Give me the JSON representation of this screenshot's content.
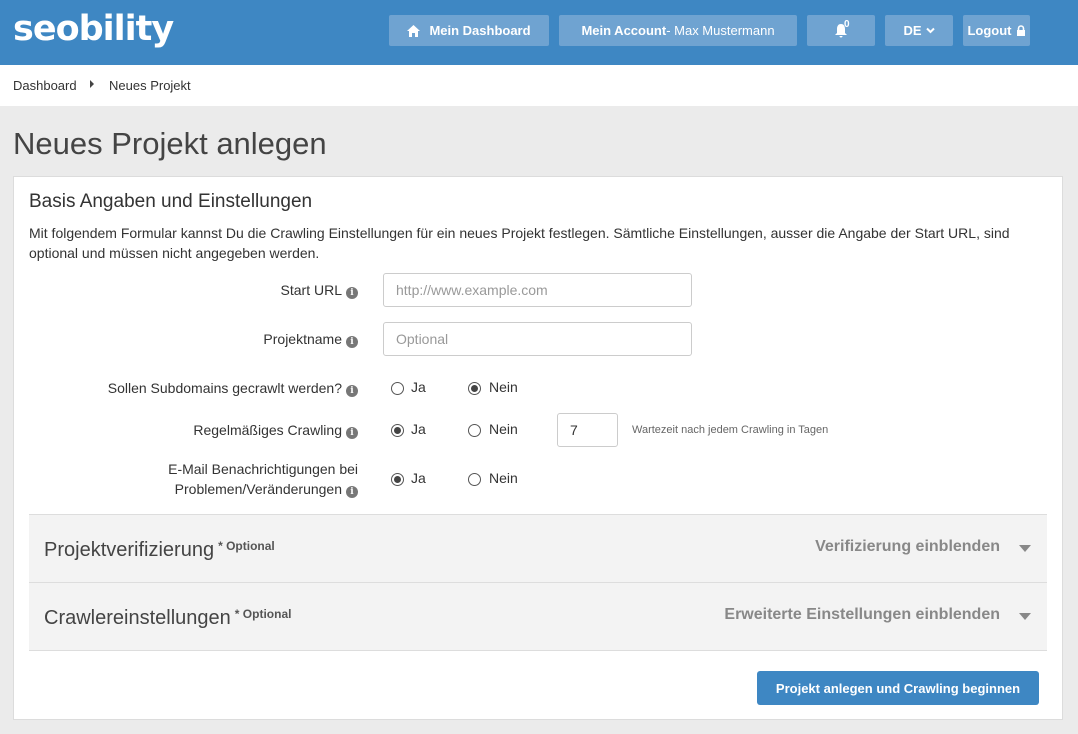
{
  "app": {
    "logo": "seobility"
  },
  "nav": {
    "dashboard": "Mein Dashboard",
    "account_label": "Mein Account",
    "account_user": " - Max Mustermann",
    "notifications_count": "0",
    "language": "DE",
    "logout": "Logout"
  },
  "breadcrumb": {
    "home": "Dashboard",
    "current": "Neues Projekt"
  },
  "page": {
    "title": "Neues Projekt anlegen"
  },
  "form": {
    "section_title": "Basis Angaben und Einstellungen",
    "description": "Mit folgendem Formular kannst Du die Crawling Einstellungen für ein neues Projekt festlegen. Sämtliche Einstellungen, ausser die Angabe der Start URL, sind optional und müssen nicht angegeben werden.",
    "start_url": {
      "label": "Start URL",
      "placeholder": "http://www.example.com",
      "value": ""
    },
    "project_name": {
      "label": "Projektname",
      "placeholder": "Optional",
      "value": ""
    },
    "subdomains": {
      "label": "Sollen Subdomains gecrawlt werden?",
      "yes": "Ja",
      "no": "Nein",
      "selected": "Nein"
    },
    "regular_crawling": {
      "label": "Regelmäßiges Crawling",
      "yes": "Ja",
      "no": "Nein",
      "selected": "Ja",
      "days_value": "7",
      "days_hint": "Wartezeit nach jedem Crawling in Tagen"
    },
    "email_notifications": {
      "label_line1": "E-Mail Benachrichtigungen bei",
      "label_line2": "Problemen/Veränderungen",
      "yes": "Ja",
      "no": "Nein",
      "selected": "Ja"
    }
  },
  "panels": {
    "verification": {
      "title": "Projektverifizierung",
      "optional": "* Optional",
      "toggle": "Verifizierung einblenden"
    },
    "crawler": {
      "title": "Crawlereinstellungen",
      "optional": "* Optional",
      "toggle": "Erweiterte Einstellungen einblenden"
    }
  },
  "actions": {
    "submit": "Projekt anlegen und Crawling beginnen"
  },
  "colors": {
    "brand": "#3e87c3",
    "nav_button": "#6fa3d1"
  }
}
